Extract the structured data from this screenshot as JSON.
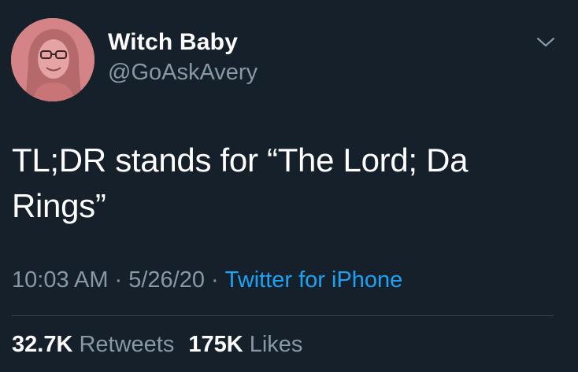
{
  "author": {
    "display_name": "Witch Baby",
    "handle": "@GoAskAvery"
  },
  "tweet": {
    "text": "TL;DR stands for “The Lord; Da Rings”",
    "time": "10:03 AM",
    "date": "5/26/20",
    "separator": "·",
    "source": "Twitter for iPhone"
  },
  "stats": {
    "retweets_count": "32.7K",
    "retweets_label": "Retweets",
    "likes_count": "175K",
    "likes_label": "Likes"
  },
  "icons": {
    "menu": "chevron-down-icon"
  },
  "colors": {
    "background": "#15202b",
    "primary_text": "#ffffff",
    "secondary_text": "#8899a6",
    "link": "#1da1f2",
    "divider": "#38444d"
  }
}
